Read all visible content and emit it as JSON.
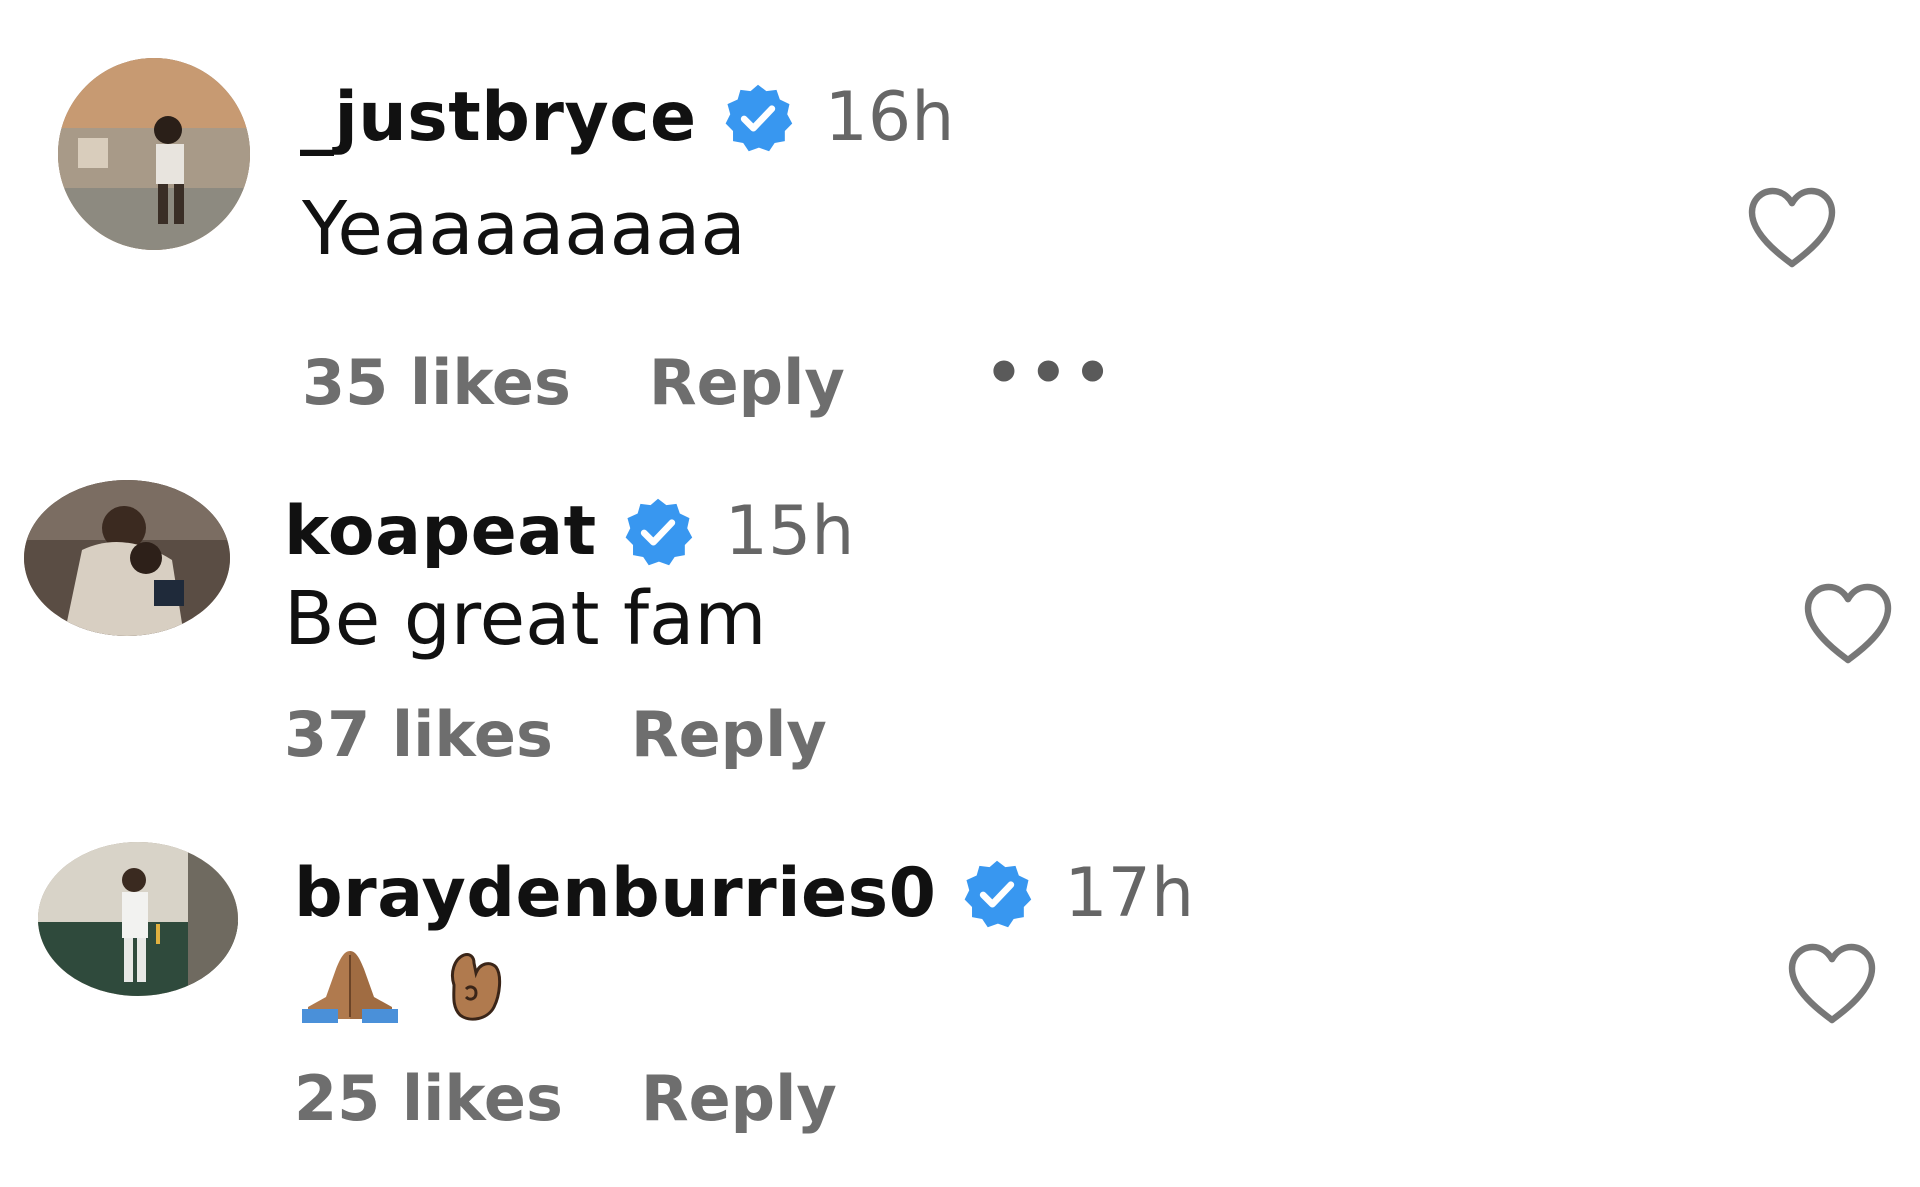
{
  "colors": {
    "verified_blue": "#3897f0",
    "meta_gray": "#6e6e6e",
    "time_gray": "#666666",
    "text": "#111111",
    "heart_outline": "#777777"
  },
  "comments": [
    {
      "avatar_icon": "profile-photo",
      "username": "_justbryce",
      "verified_icon": "verified-badge-icon",
      "time": "16h",
      "text": "Yeaaaaaaaa",
      "likes": "35 likes",
      "reply": "Reply",
      "more_icon": "more-options-icon",
      "more": "•••"
    },
    {
      "avatar_icon": "profile-photo",
      "username": "koapeat",
      "verified_icon": "verified-badge-icon",
      "time": "15h",
      "text": "Be great fam",
      "likes": "37 likes",
      "reply": "Reply"
    },
    {
      "avatar_icon": "profile-photo",
      "username": "braydenburries0",
      "verified_icon": "verified-badge-icon",
      "time": "17h",
      "text": "🙏🏽🫰🏽",
      "emoji_icons": [
        "folded-hands-icon",
        "hand-with-index-finger-and-thumb-crossed-icon"
      ],
      "likes": "25 likes",
      "reply": "Reply"
    }
  ]
}
